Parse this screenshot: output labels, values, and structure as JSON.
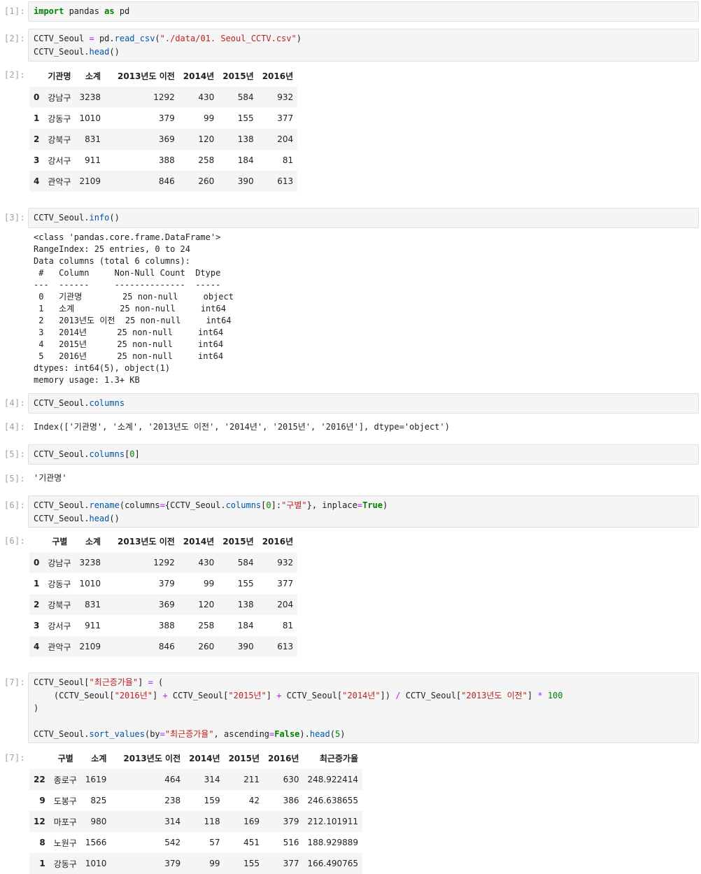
{
  "cells": {
    "c1": {
      "prompt": "[1]:",
      "code": {
        "kw1": "import",
        "mod": " pandas ",
        "kw2": "as",
        "alias": " pd"
      }
    },
    "c2": {
      "prompt": "[2]:",
      "line1": {
        "a": "CCTV_Seoul ",
        "eq": "=",
        "b": " pd.",
        "fn": "read_csv",
        "c": "(",
        "s": "\"./data/01. Seoul_CCTV.csv\"",
        "d": ")"
      },
      "line2": {
        "a": "CCTV_Seoul.",
        "fn": "head",
        "b": "()"
      },
      "out_prompt": "[2]:",
      "table": {
        "headers": [
          "기관명",
          "소계",
          "2013년도 이전",
          "2014년",
          "2015년",
          "2016년"
        ],
        "rows": [
          {
            "idx": "0",
            "c": [
              "강남구",
              "3238",
              "1292",
              "430",
              "584",
              "932"
            ]
          },
          {
            "idx": "1",
            "c": [
              "강동구",
              "1010",
              "379",
              "99",
              "155",
              "377"
            ]
          },
          {
            "idx": "2",
            "c": [
              "강북구",
              "831",
              "369",
              "120",
              "138",
              "204"
            ]
          },
          {
            "idx": "3",
            "c": [
              "강서구",
              "911",
              "388",
              "258",
              "184",
              "81"
            ]
          },
          {
            "idx": "4",
            "c": [
              "관악구",
              "2109",
              "846",
              "260",
              "390",
              "613"
            ]
          }
        ]
      }
    },
    "c3": {
      "prompt": "[3]:",
      "line1": {
        "a": "CCTV_Seoul.",
        "fn": "info",
        "b": "()"
      },
      "output": "<class 'pandas.core.frame.DataFrame'>\nRangeIndex: 25 entries, 0 to 24\nData columns (total 6 columns):\n #   Column     Non-Null Count  Dtype \n---  ------     --------------  ----- \n 0   기관명        25 non-null     object\n 1   소계         25 non-null     int64 \n 2   2013년도 이전  25 non-null     int64 \n 3   2014년      25 non-null     int64 \n 4   2015년      25 non-null     int64 \n 5   2016년      25 non-null     int64 \ndtypes: int64(5), object(1)\nmemory usage: 1.3+ KB"
    },
    "c4": {
      "prompt": "[4]:",
      "line1": {
        "a": "CCTV_Seoul.",
        "fn": "columns"
      },
      "out_prompt": "[4]:",
      "output": "Index(['기관명', '소계', '2013년도 이전', '2014년', '2015년', '2016년'], dtype='object')"
    },
    "c5": {
      "prompt": "[5]:",
      "line1": {
        "a": "CCTV_Seoul.",
        "fn": "columns",
        "b": "[",
        "n": "0",
        "c": "]"
      },
      "out_prompt": "[5]:",
      "output": "'기관명'"
    },
    "c6": {
      "prompt": "[6]:",
      "line1": {
        "a": "CCTV_Seoul.",
        "fn": "rename",
        "b": "(columns",
        "eq": "=",
        "c": "{CCTV_Seoul.",
        "fn2": "columns",
        "d": "[",
        "n": "0",
        "e": "]:",
        "s": "\"구별\"",
        "f": "}, inplace",
        "eq2": "=",
        "kw": "True",
        "g": ")"
      },
      "line2": {
        "a": "CCTV_Seoul.",
        "fn": "head",
        "b": "()"
      },
      "out_prompt": "[6]:",
      "table": {
        "headers": [
          "구별",
          "소계",
          "2013년도 이전",
          "2014년",
          "2015년",
          "2016년"
        ],
        "rows": [
          {
            "idx": "0",
            "c": [
              "강남구",
              "3238",
              "1292",
              "430",
              "584",
              "932"
            ]
          },
          {
            "idx": "1",
            "c": [
              "강동구",
              "1010",
              "379",
              "99",
              "155",
              "377"
            ]
          },
          {
            "idx": "2",
            "c": [
              "강북구",
              "831",
              "369",
              "120",
              "138",
              "204"
            ]
          },
          {
            "idx": "3",
            "c": [
              "강서구",
              "911",
              "388",
              "258",
              "184",
              "81"
            ]
          },
          {
            "idx": "4",
            "c": [
              "관악구",
              "2109",
              "846",
              "260",
              "390",
              "613"
            ]
          }
        ]
      }
    },
    "c7": {
      "prompt": "[7]:",
      "line1": {
        "a": "CCTV_Seoul[",
        "s": "\"최근증가율\"",
        "b": "] ",
        "eq": "=",
        "c": " ("
      },
      "line2": {
        "a": "    (CCTV_Seoul[",
        "s1": "\"2016년\"",
        "b": "] ",
        "op1": "+",
        "c": " CCTV_Seoul[",
        "s2": "\"2015년\"",
        "d": "] ",
        "op2": "+",
        "e": " CCTV_Seoul[",
        "s3": "\"2014년\"",
        "f": "]) ",
        "op3": "/",
        "g": " CCTV_Seoul[",
        "s4": "\"2013년도 이전\"",
        "h": "] ",
        "op4": "*",
        "i": " ",
        "n": "100"
      },
      "line3": ")",
      "line5": {
        "a": "CCTV_Seoul.",
        "fn": "sort_values",
        "b": "(by",
        "eq": "=",
        "s": "\"최근증가율\"",
        "c": ", ascending",
        "eq2": "=",
        "kw": "False",
        "d": ").",
        "fn2": "head",
        "e": "(",
        "n": "5",
        "f": ")"
      },
      "out_prompt": "[7]:",
      "table": {
        "headers": [
          "구별",
          "소계",
          "2013년도 이전",
          "2014년",
          "2015년",
          "2016년",
          "최근증가율"
        ],
        "rows": [
          {
            "idx": "22",
            "c": [
              "종로구",
              "1619",
              "464",
              "314",
              "211",
              "630",
              "248.922414"
            ]
          },
          {
            "idx": "9",
            "c": [
              "도봉구",
              "825",
              "238",
              "159",
              "42",
              "386",
              "246.638655"
            ]
          },
          {
            "idx": "12",
            "c": [
              "마포구",
              "980",
              "314",
              "118",
              "169",
              "379",
              "212.101911"
            ]
          },
          {
            "idx": "8",
            "c": [
              "노원구",
              "1566",
              "542",
              "57",
              "451",
              "516",
              "188.929889"
            ]
          },
          {
            "idx": "1",
            "c": [
              "강동구",
              "1010",
              "379",
              "99",
              "155",
              "377",
              "166.490765"
            ]
          }
        ]
      }
    }
  }
}
